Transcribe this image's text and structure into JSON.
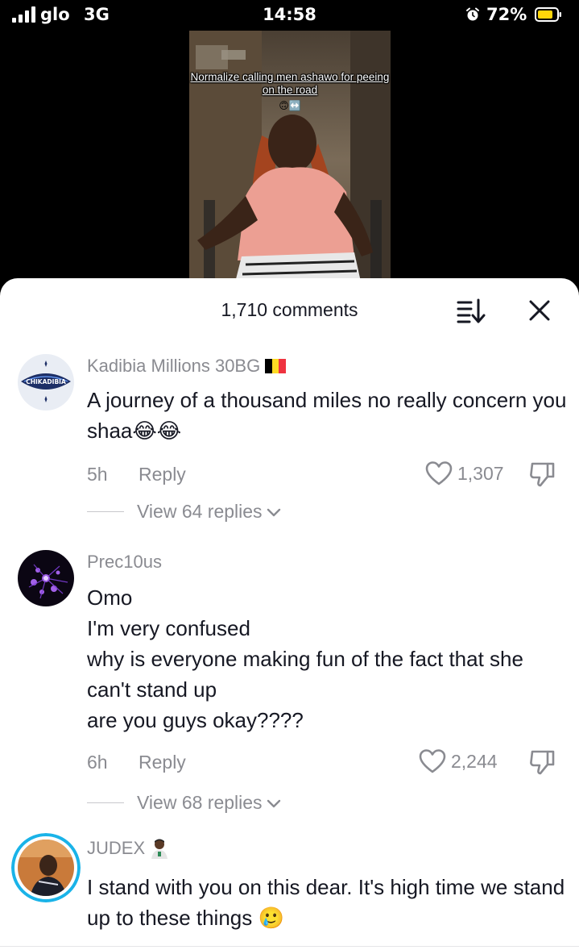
{
  "status_bar": {
    "carrier": "glo",
    "network": "3G",
    "time": "14:58",
    "battery_percent": "72%",
    "icons": [
      "signal-icon",
      "alarm-icon",
      "battery-icon"
    ]
  },
  "video": {
    "caption": "Normalize calling men ashawo for peeing on the road",
    "caption_emoji": "🙃↔️"
  },
  "comments_panel": {
    "title": "1,710 comments",
    "icons": [
      "sort-icon",
      "close-icon"
    ],
    "comments": [
      {
        "username": "Kadibia Millions 30BG",
        "username_badge": "flag-belgium-icon",
        "avatar_text": "CHIKADIBIA",
        "text": "A journey of a thousand miles no really concern you shaa😂😂",
        "time": "5h",
        "reply_label": "Reply",
        "likes": "1,307",
        "view_replies": "View 64 replies"
      },
      {
        "username": "Prec10us",
        "text": "Omo\nI'm very confused\nwhy is everyone making fun of the fact that she can't stand up\nare you guys okay????",
        "time": "6h",
        "reply_label": "Reply",
        "likes": "2,244",
        "view_replies": "View 68 replies"
      },
      {
        "username": "JUDEX",
        "username_badge": "person-emoji-icon",
        "text": "I stand with you on this dear. It's high time we stand up to these things 🥲"
      }
    ]
  },
  "colors": {
    "primary_text": "#161823",
    "secondary_text": "#8a8b91",
    "background_top": "#000000",
    "sheet_background": "#ffffff",
    "story_ring": "#1ab3e8"
  }
}
